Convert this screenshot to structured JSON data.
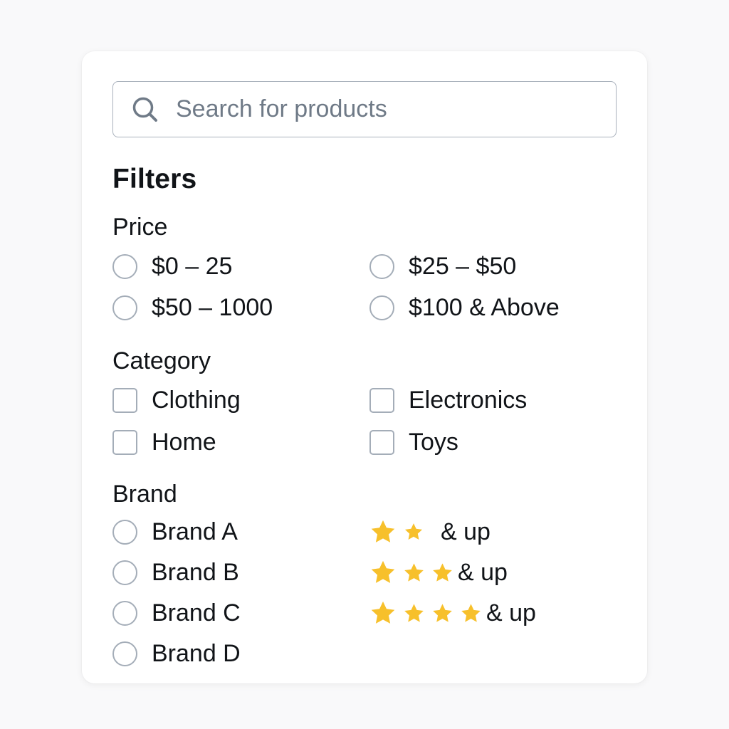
{
  "search": {
    "placeholder": "Search for products"
  },
  "filters_title": "Filters",
  "price": {
    "title": "Price",
    "options": [
      "$0 – 25",
      "$25 – $50",
      "$50 – 1000",
      "$100 & Above"
    ]
  },
  "category": {
    "title": "Category",
    "options": [
      "Clothing",
      "Electronics",
      "Home",
      "Toys"
    ]
  },
  "brand": {
    "title": "Brand",
    "options": [
      "Brand A",
      "Brand B",
      "Brand C",
      "Brand D"
    ]
  },
  "rating": {
    "label": "& up",
    "options": [
      {
        "stars": 2,
        "label": "& up"
      },
      {
        "stars": 3,
        "label": "& up"
      },
      {
        "stars": 4,
        "label": "& up"
      }
    ]
  },
  "colors": {
    "star": "#f7c02b",
    "border": "#a4adb8",
    "text": "#111418",
    "placeholder": "#6f7a87"
  }
}
